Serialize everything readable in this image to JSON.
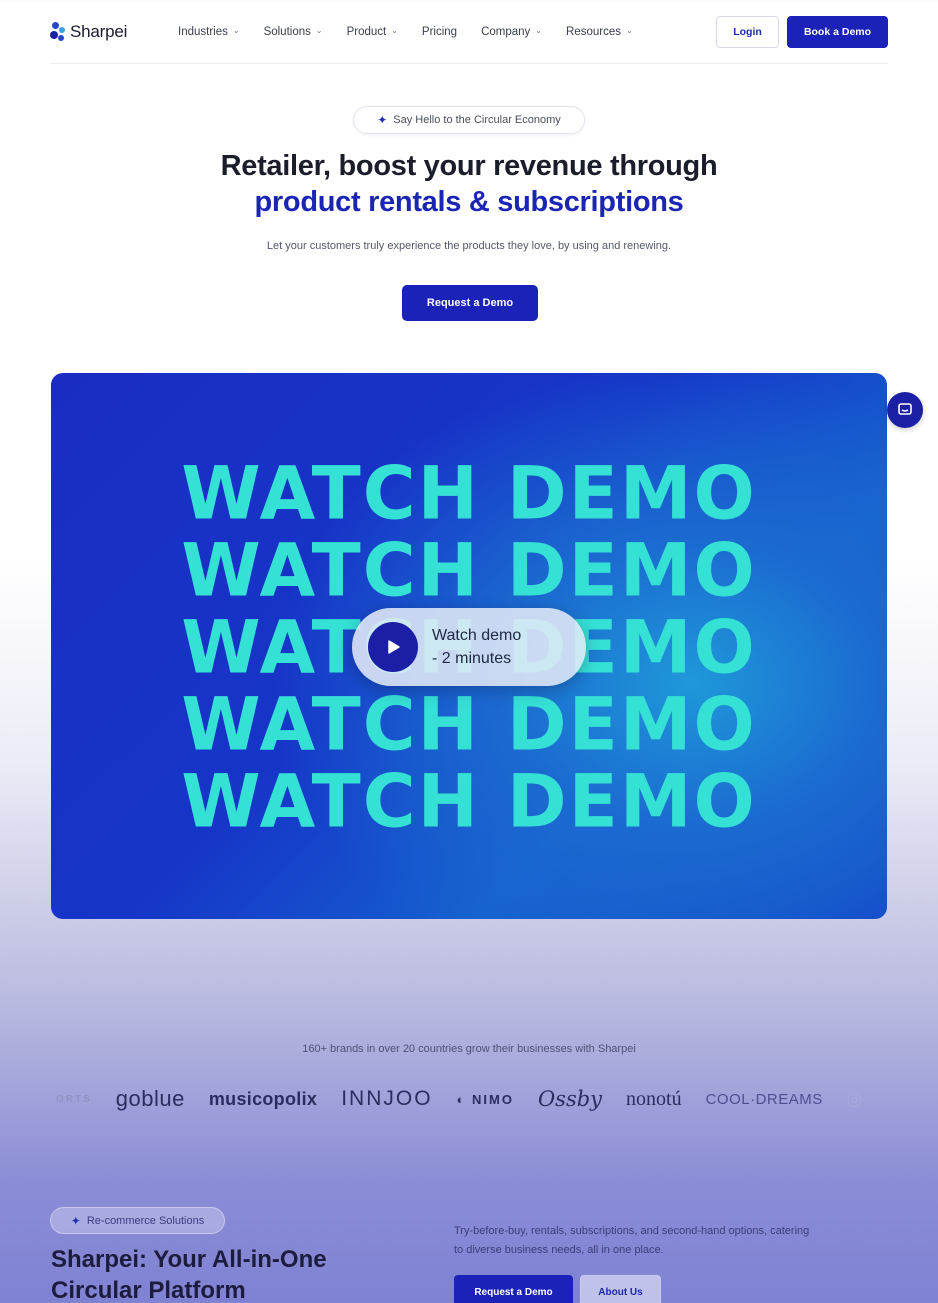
{
  "nav": {
    "logo_text": "Sharpei",
    "items": [
      {
        "label": "Industries",
        "has_dropdown": true
      },
      {
        "label": "Solutions",
        "has_dropdown": true
      },
      {
        "label": "Product",
        "has_dropdown": true
      },
      {
        "label": "Pricing",
        "has_dropdown": false
      },
      {
        "label": "Company",
        "has_dropdown": true
      },
      {
        "label": "Resources",
        "has_dropdown": true
      }
    ],
    "login_label": "Login",
    "book_demo_label": "Book a Demo"
  },
  "hero": {
    "pill_text": "Say Hello to the Circular Economy",
    "title_line1": "Retailer, boost your revenue through",
    "title_line2": "product rentals & subscriptions",
    "subtitle": "Let your customers truly experience the products they love, by using and renewing.",
    "cta_label": "Request a Demo"
  },
  "video": {
    "watch_lines": [
      "WATCH DEMO",
      "WATCH DEMO",
      "WATCH DEMO",
      "WATCH DEMO",
      "WATCH DEMO"
    ],
    "play_line1": "Watch demo",
    "play_line2": "- 2 minutes"
  },
  "brands": {
    "caption": "160+ brands in over 20 countries grow their businesses with Sharpei",
    "logos": [
      "ORTS",
      "goblue",
      "musicopolix",
      "INNJOO",
      "NIMO",
      "Ossby",
      "nonotú",
      "COOL·DREAMS"
    ]
  },
  "section": {
    "tag": "Re-commerce Solutions",
    "title_line1": "Sharpei: Your All-in-One",
    "title_line2": "Circular Platform",
    "text": "Try-before-buy, rentals, subscriptions, and second-hand options, catering to diverse business needs, all in one place.",
    "request_label": "Request a Demo",
    "about_label": "About Us"
  },
  "colors": {
    "brand_primary": "#1a22b8",
    "brand_text_blue": "#1b25b3",
    "watch_demo_text": "#35e0d5"
  },
  "icons": [
    "sparkle-icon",
    "chevron-down-icon",
    "play-icon",
    "chat-icon"
  ]
}
